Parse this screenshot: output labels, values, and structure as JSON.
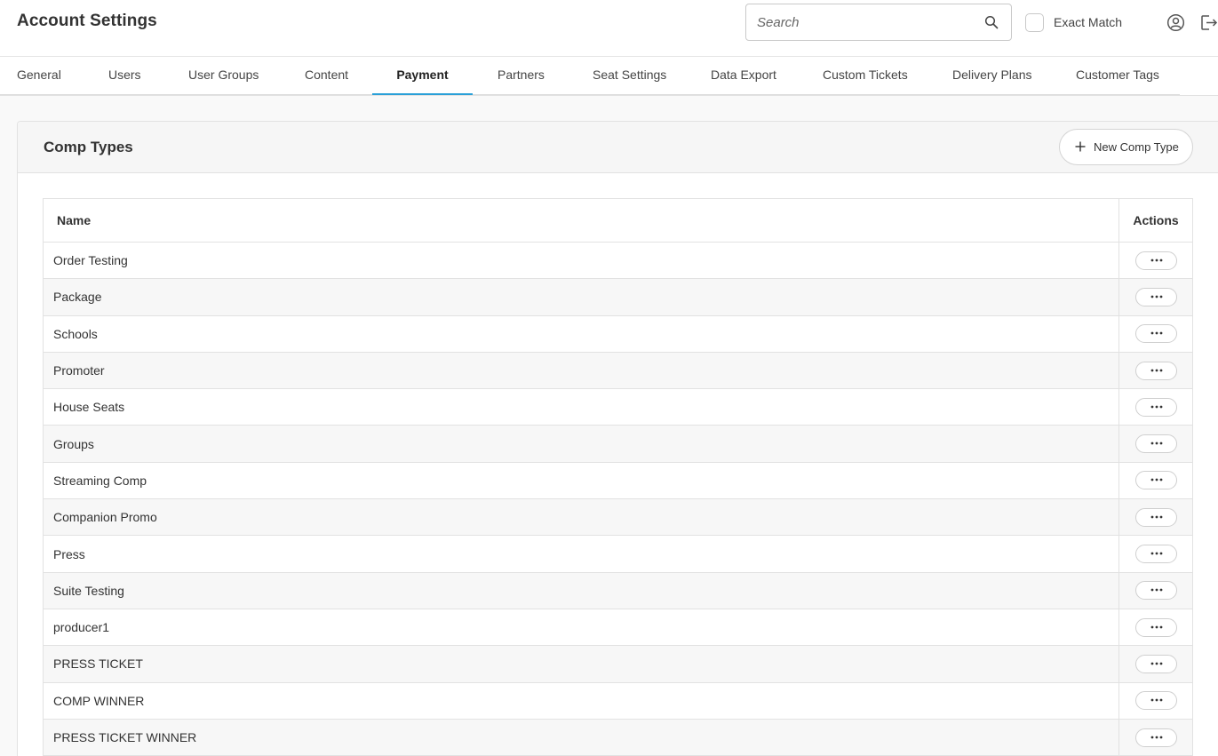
{
  "header": {
    "title": "Account Settings",
    "search_placeholder": "Search",
    "exact_match_label": "Exact Match"
  },
  "tabs": [
    {
      "label": "General"
    },
    {
      "label": "Users"
    },
    {
      "label": "User Groups"
    },
    {
      "label": "Content"
    },
    {
      "label": "Payment",
      "active": true
    },
    {
      "label": "Partners"
    },
    {
      "label": "Seat Settings"
    },
    {
      "label": "Data Export"
    },
    {
      "label": "Custom Tickets"
    },
    {
      "label": "Delivery Plans"
    },
    {
      "label": "Customer Tags"
    }
  ],
  "section": {
    "title": "Comp Types",
    "new_button_label": "New Comp Type"
  },
  "table": {
    "columns": {
      "name": "Name",
      "actions": "Actions"
    },
    "rows": [
      "Order Testing",
      "Package",
      "Schools",
      "Promoter",
      "House Seats",
      "Groups",
      "Streaming Comp",
      "Companion Promo",
      "Press",
      "Suite Testing",
      "producer1",
      "PRESS TICKET",
      "COMP WINNER",
      "PRESS TICKET WINNER"
    ]
  },
  "colors": {
    "accent": "#2aa0d8",
    "row_alt": "#f7f7f7",
    "border": "#e2e2e2"
  },
  "icons": {
    "search": "search-icon",
    "user": "user-circle-icon",
    "logout": "logout-icon",
    "plus": "plus-icon",
    "more": "more-dots-icon"
  }
}
